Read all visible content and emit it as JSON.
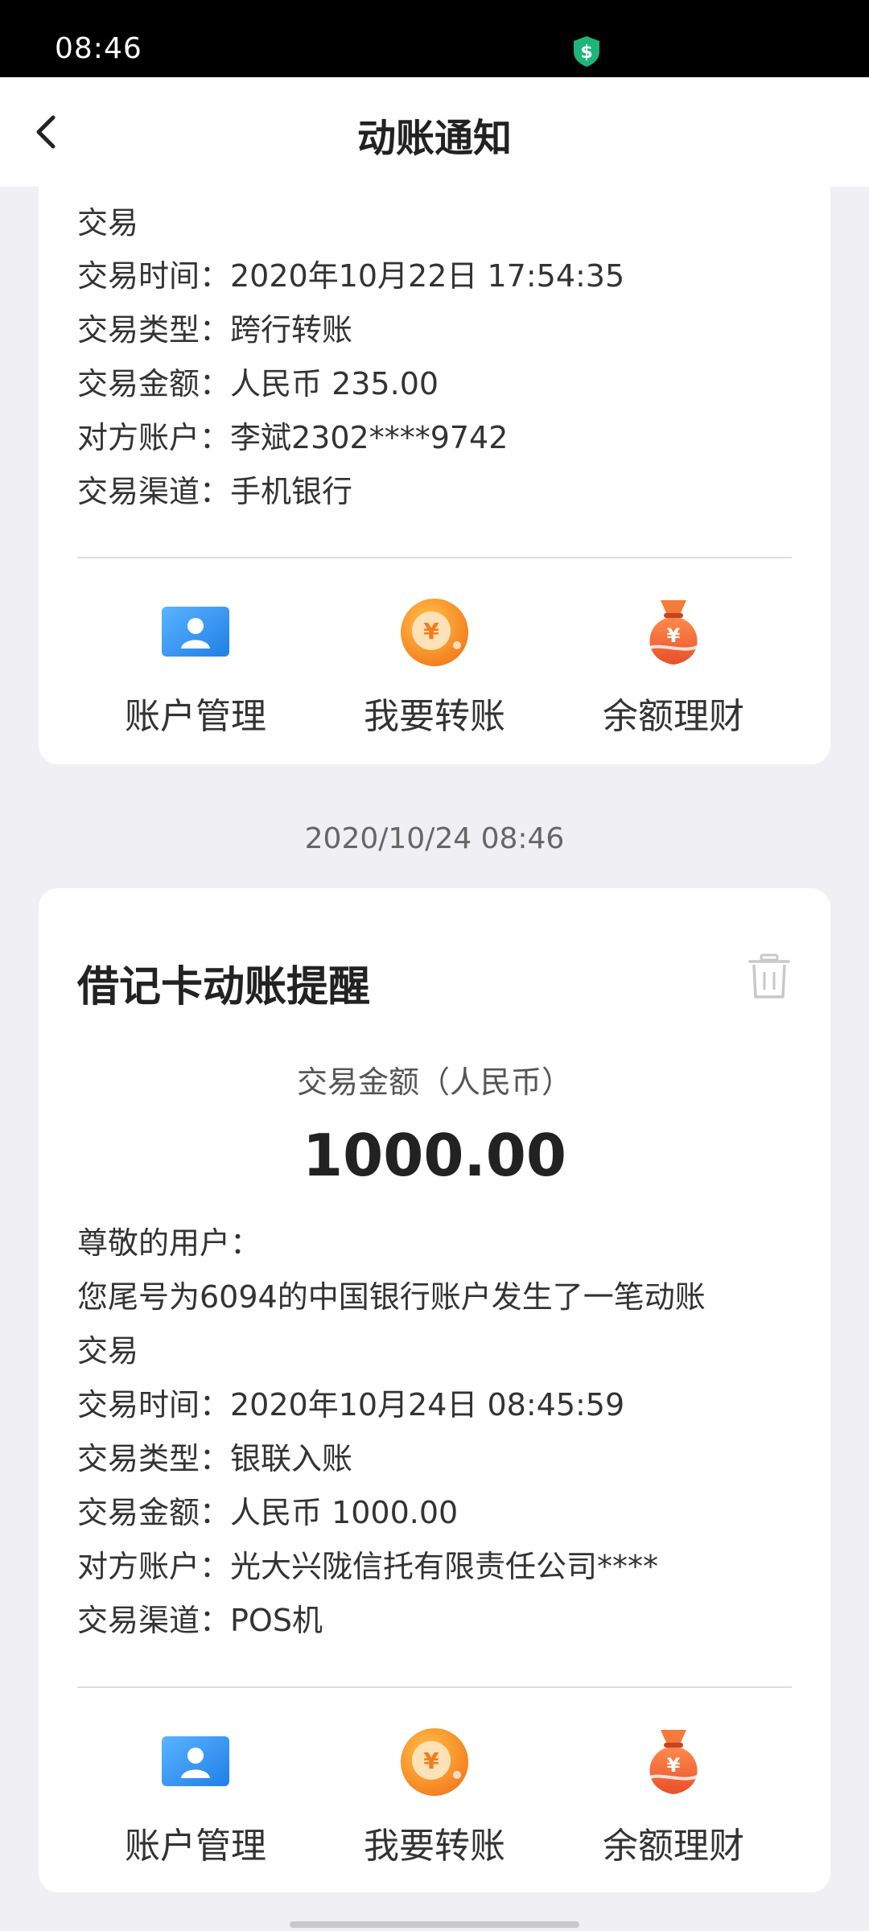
{
  "status_bar": {
    "time": "08:46"
  },
  "nav": {
    "title": "动账通知"
  },
  "card1": {
    "lines": [
      "交易",
      "交易时间：2020年10月22日 17:54:35",
      "交易类型：跨行转账",
      "交易金额：人民币 235.00",
      "对方账户：李斌2302****9742",
      "交易渠道：手机银行"
    ]
  },
  "timestamp": "2020/10/24 08:46",
  "card2": {
    "title": "借记卡动账提醒",
    "amount_label": "交易金额（人民币）",
    "amount": "1000.00",
    "lines": [
      "尊敬的用户：",
      "您尾号为6094的中国银行账户发生了一笔动账",
      "交易",
      "交易时间：2020年10月24日 08:45:59",
      "交易类型：银联入账",
      "交易金额：人民币 1000.00",
      "对方账户：光大兴陇信托有限责任公司****",
      "交易渠道：POS机"
    ]
  },
  "actions": {
    "account": "账户管理",
    "transfer": "我要转账",
    "wealth": "余额理财"
  },
  "colors": {
    "accent_blue": "#2f8ff0",
    "accent_orange": "#f58a1f",
    "accent_red_orange": "#f0643a"
  },
  "icons": [
    "back-arrow-icon",
    "shield-icon",
    "account-card-icon",
    "yuan-coin-icon",
    "money-bag-icon",
    "trash-icon"
  ]
}
